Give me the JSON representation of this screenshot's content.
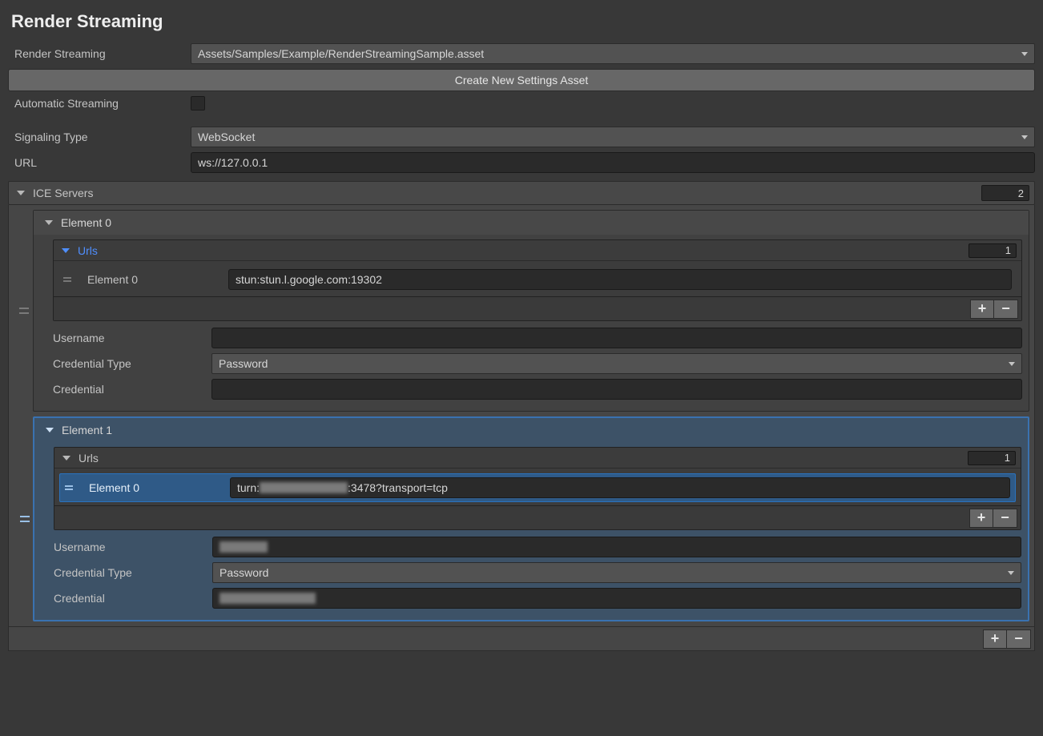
{
  "header": {
    "title": "Render Streaming"
  },
  "settings": {
    "render_streaming_label": "Render Streaming",
    "asset_path": "Assets/Samples/Example/RenderStreamingSample.asset",
    "create_button": "Create New Settings Asset",
    "automatic_streaming_label": "Automatic Streaming",
    "signaling_type_label": "Signaling Type",
    "signaling_type_value": "WebSocket",
    "url_label": "URL",
    "url_value": "ws://127.0.0.1"
  },
  "ice": {
    "header": "ICE Servers",
    "count": "2",
    "elements": [
      {
        "title": "Element 0",
        "urls": {
          "label": "Urls",
          "count": "1",
          "items": [
            {
              "label": "Element 0",
              "value": "stun:stun.l.google.com:19302"
            }
          ]
        },
        "username_label": "Username",
        "username_value": "",
        "credential_type_label": "Credential Type",
        "credential_type_value": "Password",
        "credential_label": "Credential",
        "credential_value": ""
      },
      {
        "title": "Element 1",
        "urls": {
          "label": "Urls",
          "count": "1",
          "items": [
            {
              "label": "Element 0",
              "value_prefix": "turn:",
              "value_suffix": ":3478?transport=tcp"
            }
          ]
        },
        "username_label": "Username",
        "credential_type_label": "Credential Type",
        "credential_type_value": "Password",
        "credential_label": "Credential"
      }
    ]
  },
  "icons": {
    "plus": "+",
    "minus": "−"
  }
}
